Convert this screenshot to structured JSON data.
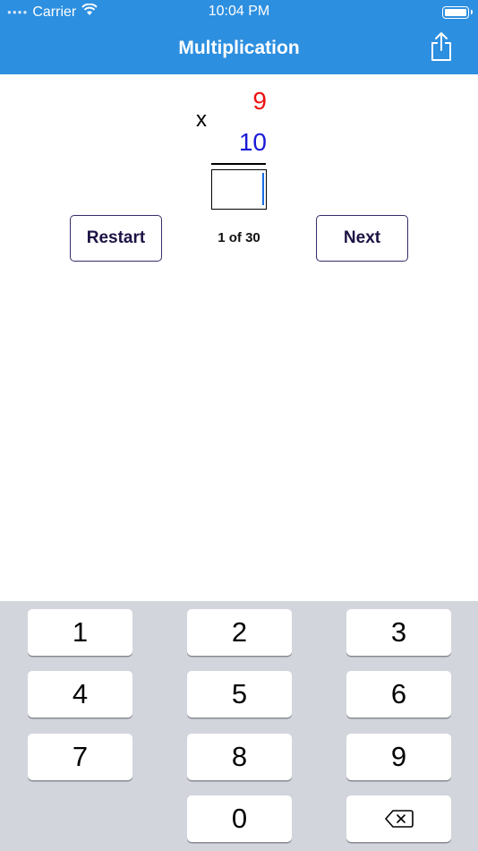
{
  "status_bar": {
    "carrier": "Carrier",
    "time": "10:04 PM"
  },
  "nav": {
    "title": "Multiplication",
    "share_icon": "share-icon"
  },
  "problem": {
    "operator": "x",
    "top_number": "9",
    "bottom_number": "10",
    "answer_value": "",
    "top_color": "#ee1010",
    "bottom_color": "#1a1ad8"
  },
  "controls": {
    "restart_label": "Restart",
    "next_label": "Next",
    "progress": "1 of 30"
  },
  "keypad": {
    "keys": [
      "1",
      "2",
      "3",
      "4",
      "5",
      "6",
      "7",
      "8",
      "9",
      "0"
    ],
    "backspace_icon": "backspace-icon"
  },
  "colors": {
    "accent": "#2d8fe0",
    "button_border": "#3a2a6a",
    "keyboard_bg": "#d2d5db"
  }
}
